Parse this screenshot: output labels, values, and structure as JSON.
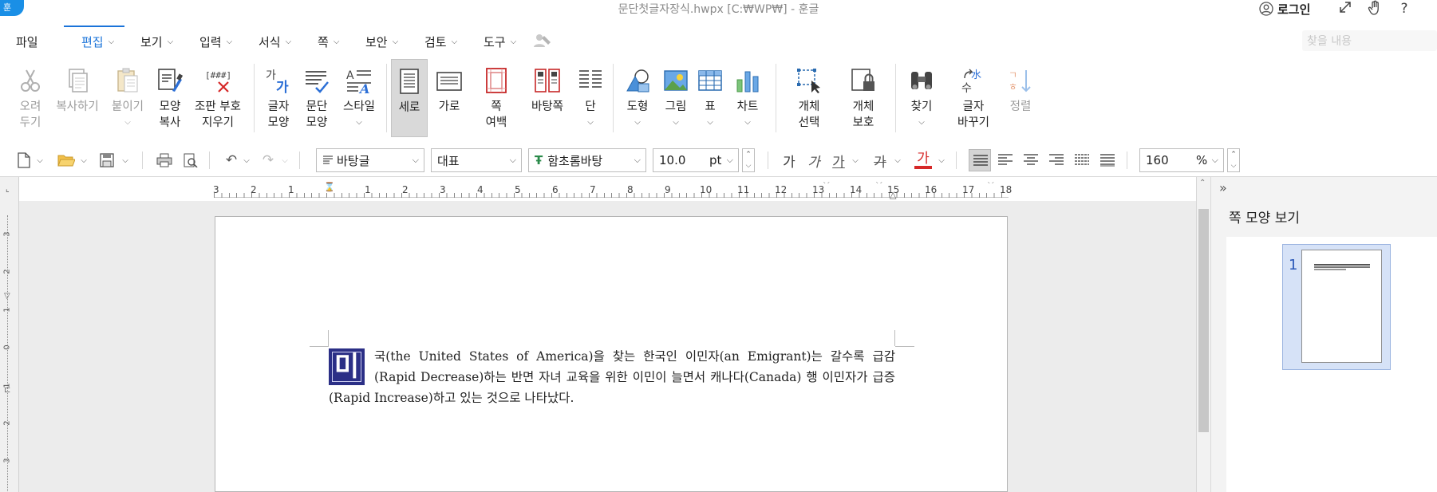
{
  "titlebar": {
    "title": "문단첫글자장식.hwpx [C:₩WP₩] - 훈글",
    "logo": "훈",
    "login": "로그인",
    "icons": [
      "user-icon",
      "expand-icon",
      "hand-icon",
      "help-icon"
    ]
  },
  "menubar": {
    "file": "파일",
    "menus": [
      "편집",
      "보기",
      "입력",
      "서식",
      "쪽",
      "보안",
      "검토",
      "도구"
    ],
    "active": "편집",
    "search_placeholder": "찾을 내용"
  },
  "ribbon": {
    "cut": "오려\n두기",
    "copy": "복사하기",
    "paste": "붙이기",
    "format_painter": "모양\n복사",
    "clear_layout": "조판 부호\n지우기",
    "char_shape": "글자\n모양",
    "para_shape": "문단\n모양",
    "style": "스타일",
    "portrait": "세로",
    "landscape": "가로",
    "margins": "쪽\n여백",
    "page_border": "바탕쪽",
    "columns": "단",
    "shapes": "도형",
    "picture": "그림",
    "table": "표",
    "chart": "차트",
    "select_object": "개체\n선택",
    "protect_object": "개체\n보호",
    "find": "찾기",
    "replace_char": "글자\n바꾸기",
    "sort": "정렬",
    "clear_layout_glyph": "[###]"
  },
  "format": {
    "style": "바탕글",
    "lang": "대표",
    "font": "함초롬바탕",
    "font_glyph": "Ŧ",
    "size": "10.0",
    "unit": "pt",
    "zoom": "160",
    "zoom_unit": "%",
    "char_buttons": [
      "가",
      "가",
      "가",
      "가",
      "가"
    ]
  },
  "hruler": {
    "labels": [
      "3",
      "2",
      "1",
      "1",
      "2",
      "3",
      "4",
      "5",
      "6",
      "7",
      "8",
      "9",
      "10",
      "11",
      "12",
      "13",
      "14",
      "15",
      "16",
      "17",
      "18"
    ]
  },
  "vruler": {
    "labels": [
      "3",
      "2",
      "1",
      "0",
      "1",
      "2",
      "3"
    ]
  },
  "document": {
    "dropcap": "미",
    "text": "국(the United States of America)을 찾는 한국인 이민자(an Emigrant)는 갈수록 급감(Rapid Decrease)하는 반면 자녀 교육을 위한 이민이 늘면서 캐나다(Canada) 행 이민자가 급증(Rapid Increase)하고 있는 것으로 나타났다."
  },
  "rpane": {
    "collapse": "»",
    "title": "쪽 모양 보기",
    "page_number": "1"
  }
}
